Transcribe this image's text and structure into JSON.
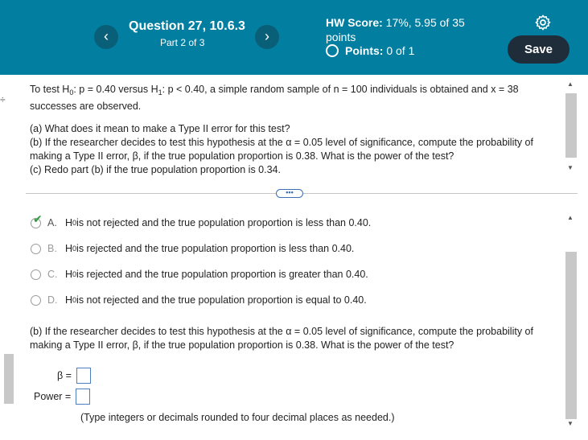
{
  "header": {
    "prev_icon": "chevron-left",
    "next_icon": "chevron-right",
    "question_title": "Question 27, 10.6.3",
    "question_part": "Part 2 of 3",
    "hw_score_label": "HW Score:",
    "hw_score_value": " 17%, 5.95 of 35 points",
    "points_label": "Points:",
    "points_value": " 0 of 1",
    "settings_icon": "gear-icon",
    "save_label": "Save"
  },
  "question": {
    "intro_1": "To test H",
    "intro_2": ": p = 0.40 versus H",
    "intro_3": ": p < 0.40, a simple random sample of n = 100 individuals is obtained and x = 38",
    "intro_line2": "successes are observed.",
    "sub0": "0",
    "sub1": "1",
    "part_a": "(a) What does it mean to make a Type II error for this test?",
    "part_b": "(b) If the researcher decides to test this hypothesis at the α = 0.05 level of significance, compute the probability of making a Type II error, β, if the true population proportion is 0.38. What is the power of the test?",
    "part_c": "(c) Redo part (b) if the true population proportion is 0.34."
  },
  "divider_label": "•••",
  "options": [
    {
      "letter": "A.",
      "text_pre": "H",
      "sub": "0",
      "text": " is not rejected and the true population proportion is less than 0.40.",
      "selected": true
    },
    {
      "letter": "B.",
      "text_pre": "H",
      "sub": "0",
      "text": " is rejected and the true population proportion is less than 0.40.",
      "selected": false
    },
    {
      "letter": "C.",
      "text_pre": "H",
      "sub": "0",
      "text": " is rejected and the true population proportion is greater than 0.40.",
      "selected": false
    },
    {
      "letter": "D.",
      "text_pre": "H",
      "sub": "0",
      "text": " is not rejected and the true population proportion is equal to 0.40.",
      "selected": false
    }
  ],
  "answer_part_b": {
    "prompt": "(b) If the researcher decides to test this hypothesis at the α = 0.05 level of significance, compute the probability of making a Type II error, β, if the true population proportion is 0.38. What is the power of the test?",
    "beta_label": "β =",
    "beta_value": "",
    "power_label": "Power =",
    "power_value": "",
    "hint": "(Type integers or decimals rounded to four decimal places as needed.)"
  },
  "colors": {
    "header_bg": "#027ea0",
    "save_bg": "#1f2d3a",
    "check": "#2a9a3a"
  }
}
